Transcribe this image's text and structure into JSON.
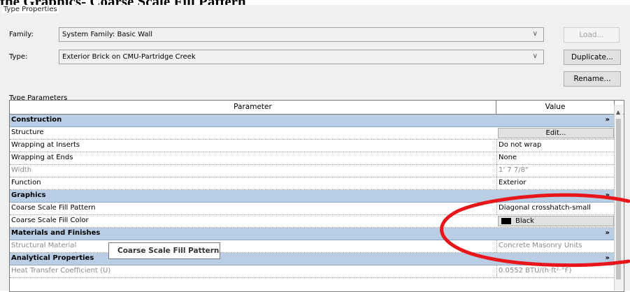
{
  "document_heading": "the Graphics- Coarse Scale Fill Pattern",
  "dialog": {
    "title": "Type Properties",
    "family_label": "Family:",
    "family_value": "System Family: Basic Wall",
    "type_label": "Type:",
    "type_value": "Exterior Brick on CMU-Partridge Creek",
    "load_button": "Load...",
    "duplicate_button": "Duplicate...",
    "rename_button": "Rename...",
    "type_parameters_label": "Type Parameters"
  },
  "grid": {
    "header_parameter": "Parameter",
    "header_value": "Value",
    "header_eq": "=",
    "rows": [
      {
        "kind": "group",
        "name": "Construction",
        "value": ""
      },
      {
        "kind": "param",
        "name": "Structure",
        "value": "Edit..."
      },
      {
        "kind": "param",
        "name": "Wrapping at Inserts",
        "value": "Do not wrap"
      },
      {
        "kind": "param",
        "name": "Wrapping at Ends",
        "value": "None"
      },
      {
        "kind": "dim",
        "name": "Width",
        "value": "1'  7 7/8\""
      },
      {
        "kind": "param",
        "name": "Function",
        "value": "Exterior"
      },
      {
        "kind": "group",
        "name": "Graphics",
        "value": ""
      },
      {
        "kind": "param",
        "name": "Coarse Scale Fill Pattern",
        "value": "Diagonal crosshatch-small"
      },
      {
        "kind": "param",
        "name": "Coarse Scale Fill Color",
        "value": "Black"
      },
      {
        "kind": "group",
        "name": "Materials and Finishes",
        "value": ""
      },
      {
        "kind": "dim",
        "name": "Structural Material",
        "value": "Concrete Masonry Units"
      },
      {
        "kind": "group",
        "name": "Analytical Properties",
        "value": ""
      },
      {
        "kind": "dim",
        "name": "Heat Transfer Coefficient (U)",
        "value": "0.0552 BTU/(h·ft²·°F)"
      }
    ],
    "collapse_glyph": "»"
  },
  "tooltip": "Coarse Scale Fill Pattern",
  "colors": {
    "group_band": "#b9cde5",
    "annotation": "#e8161b",
    "swatch": "#000000"
  }
}
